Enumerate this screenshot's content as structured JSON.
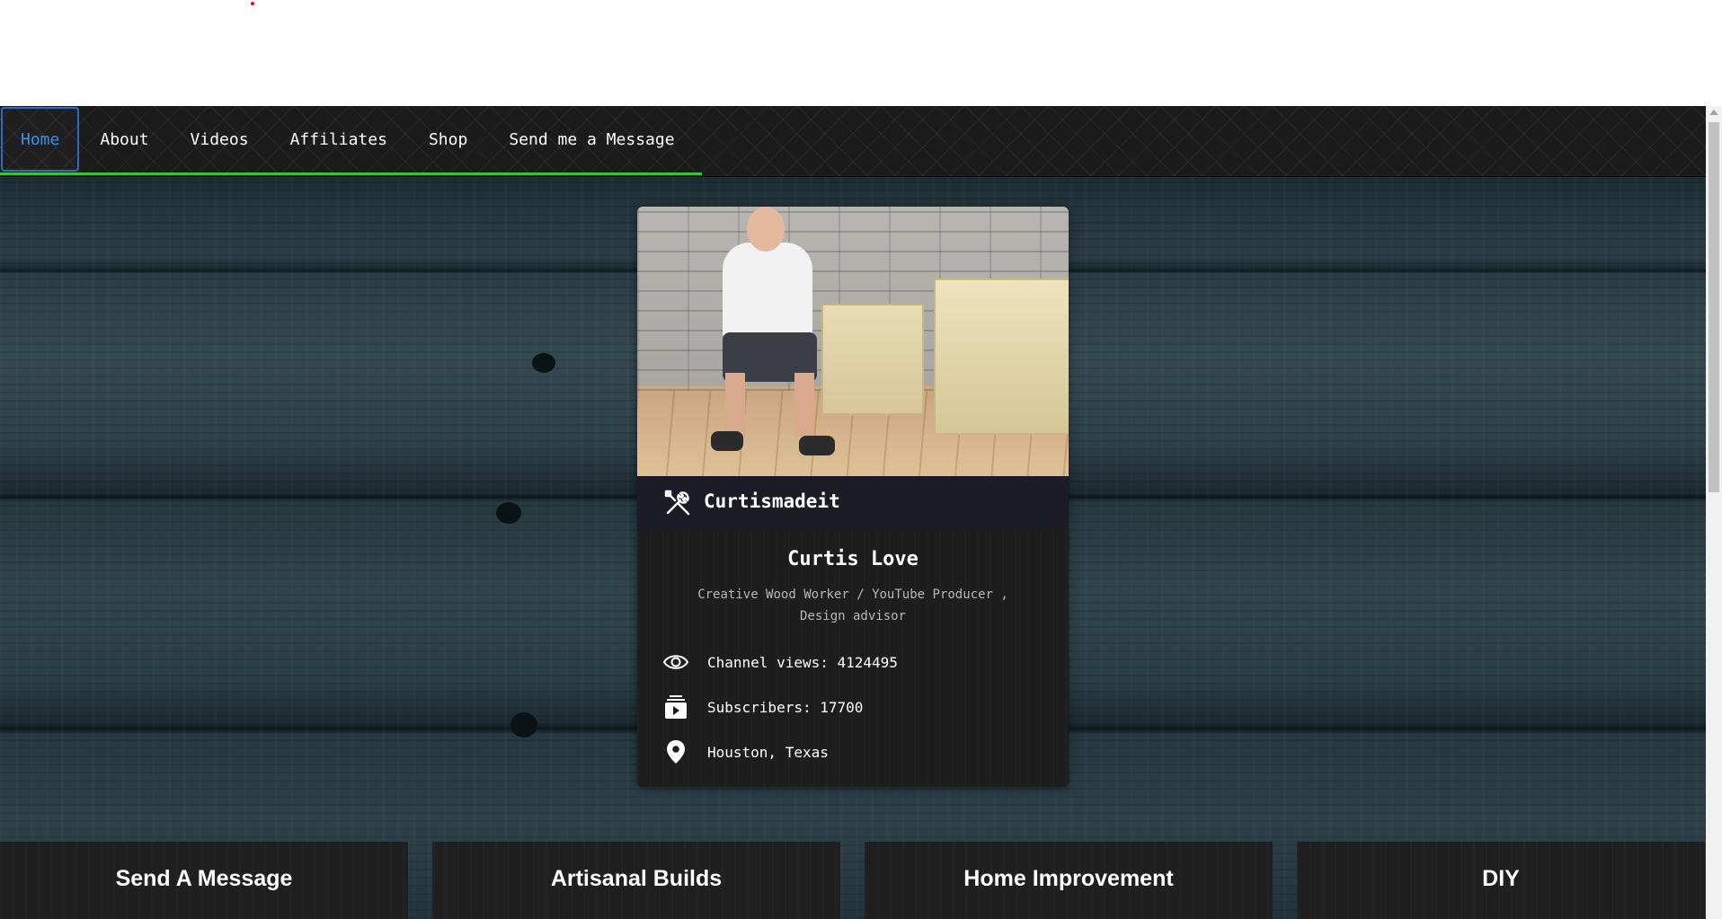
{
  "nav": {
    "items": [
      {
        "label": "Home",
        "active": true
      },
      {
        "label": "About"
      },
      {
        "label": "Videos"
      },
      {
        "label": "Affiliates"
      },
      {
        "label": "Shop"
      },
      {
        "label": "Send me a Message"
      }
    ],
    "accent_color": "#3fbf3f",
    "active_color": "#3c8fe6"
  },
  "profile": {
    "photo_icon": "profile-photo",
    "brand_icon": "tools-icon",
    "brand_name": "Curtismadeit",
    "name": "Curtis Love",
    "role": "Creative Wood Worker / YouTube Producer , Design advisor",
    "stats": [
      {
        "icon": "eye-icon",
        "text": "Channel views: 4124495"
      },
      {
        "icon": "subscriptions-icon",
        "text": "Subscribers: 17700"
      },
      {
        "icon": "location-pin-icon",
        "text": "Houston, Texas"
      }
    ]
  },
  "features": [
    {
      "title": "Send A Message"
    },
    {
      "title": "Artisanal Builds"
    },
    {
      "title": "Home Improvement"
    },
    {
      "title": "DIY"
    }
  ]
}
